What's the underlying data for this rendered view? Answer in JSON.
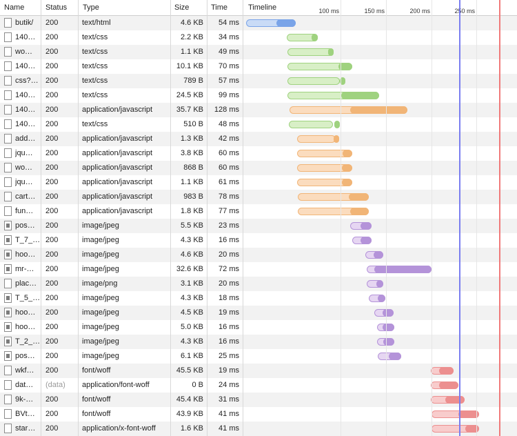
{
  "columns": {
    "name": "Name",
    "status": "Status",
    "type": "Type",
    "size": "Size",
    "time": "Time",
    "timeline": "Timeline"
  },
  "ticks": [
    "100 ms",
    "150 ms",
    "200 ms",
    "250 ms"
  ],
  "colors": {
    "html_light": "#c9dbf6",
    "html_dark": "#7aa4e8",
    "css_light": "#d8efc6",
    "css_dark": "#9fd27f",
    "js_light": "#fbdcbe",
    "js_dark": "#f1b577",
    "img_light": "#e6d6f2",
    "img_dark": "#b493d9",
    "font_light": "#f8cccc",
    "font_dark": "#ec8f8f"
  },
  "rows": [
    {
      "name": "butik/",
      "status": "200",
      "type": "text/html",
      "size": "4.6 KB",
      "time": "54 ms",
      "icon": "file-icon",
      "kind": "html"
    },
    {
      "name": "140…",
      "status": "200",
      "type": "text/css",
      "size": "2.2 KB",
      "time": "34 ms",
      "icon": "file-icon",
      "kind": "css"
    },
    {
      "name": "wo…",
      "status": "200",
      "type": "text/css",
      "size": "1.1 KB",
      "time": "49 ms",
      "icon": "file-icon",
      "kind": "css"
    },
    {
      "name": "140…",
      "status": "200",
      "type": "text/css",
      "size": "10.1 KB",
      "time": "70 ms",
      "icon": "file-icon",
      "kind": "css"
    },
    {
      "name": "css?…",
      "status": "200",
      "type": "text/css",
      "size": "789 B",
      "time": "57 ms",
      "icon": "file-icon",
      "kind": "css"
    },
    {
      "name": "140…",
      "status": "200",
      "type": "text/css",
      "size": "24.5 KB",
      "time": "99 ms",
      "icon": "file-icon",
      "kind": "css"
    },
    {
      "name": "140…",
      "status": "200",
      "type": "application/javascript",
      "size": "35.7 KB",
      "time": "128 ms",
      "icon": "file-icon",
      "kind": "js"
    },
    {
      "name": "140…",
      "status": "200",
      "type": "text/css",
      "size": "510 B",
      "time": "48 ms",
      "icon": "file-icon",
      "kind": "css"
    },
    {
      "name": "add…",
      "status": "200",
      "type": "application/javascript",
      "size": "1.3 KB",
      "time": "42 ms",
      "icon": "file-icon",
      "kind": "js"
    },
    {
      "name": "jqu…",
      "status": "200",
      "type": "application/javascript",
      "size": "3.8 KB",
      "time": "60 ms",
      "icon": "file-icon",
      "kind": "js"
    },
    {
      "name": "wo…",
      "status": "200",
      "type": "application/javascript",
      "size": "868 B",
      "time": "60 ms",
      "icon": "file-icon",
      "kind": "js"
    },
    {
      "name": "jqu…",
      "status": "200",
      "type": "application/javascript",
      "size": "1.1 KB",
      "time": "61 ms",
      "icon": "file-icon",
      "kind": "js"
    },
    {
      "name": "cart…",
      "status": "200",
      "type": "application/javascript",
      "size": "983 B",
      "time": "78 ms",
      "icon": "file-icon",
      "kind": "js"
    },
    {
      "name": "fun…",
      "status": "200",
      "type": "application/javascript",
      "size": "1.8 KB",
      "time": "77 ms",
      "icon": "file-icon",
      "kind": "js"
    },
    {
      "name": "pos…",
      "status": "200",
      "type": "image/jpeg",
      "size": "5.5 KB",
      "time": "23 ms",
      "icon": "image-thumbnail-icon",
      "kind": "img"
    },
    {
      "name": "T_7_…",
      "status": "200",
      "type": "image/jpeg",
      "size": "4.3 KB",
      "time": "16 ms",
      "icon": "image-thumbnail-icon",
      "kind": "img"
    },
    {
      "name": "hoo…",
      "status": "200",
      "type": "image/jpeg",
      "size": "4.6 KB",
      "time": "20 ms",
      "icon": "image-thumbnail-icon",
      "kind": "img"
    },
    {
      "name": "mr-…",
      "status": "200",
      "type": "image/jpeg",
      "size": "32.6 KB",
      "time": "72 ms",
      "icon": "image-thumbnail-icon",
      "kind": "img"
    },
    {
      "name": "plac…",
      "status": "200",
      "type": "image/png",
      "size": "3.1 KB",
      "time": "20 ms",
      "icon": "file-icon",
      "kind": "img"
    },
    {
      "name": "T_5_…",
      "status": "200",
      "type": "image/jpeg",
      "size": "4.3 KB",
      "time": "18 ms",
      "icon": "image-thumbnail-icon",
      "kind": "img"
    },
    {
      "name": "hoo…",
      "status": "200",
      "type": "image/jpeg",
      "size": "4.5 KB",
      "time": "19 ms",
      "icon": "image-thumbnail-icon",
      "kind": "img"
    },
    {
      "name": "hoo…",
      "status": "200",
      "type": "image/jpeg",
      "size": "5.0 KB",
      "time": "16 ms",
      "icon": "image-thumbnail-icon",
      "kind": "img"
    },
    {
      "name": "T_2_…",
      "status": "200",
      "type": "image/jpeg",
      "size": "4.3 KB",
      "time": "16 ms",
      "icon": "image-thumbnail-icon",
      "kind": "img"
    },
    {
      "name": "pos…",
      "status": "200",
      "type": "image/jpeg",
      "size": "6.1 KB",
      "time": "25 ms",
      "icon": "image-thumbnail-icon",
      "kind": "img"
    },
    {
      "name": "wkf…",
      "status": "200",
      "type": "font/woff",
      "size": "45.5 KB",
      "time": "19 ms",
      "icon": "file-icon",
      "kind": "font"
    },
    {
      "name": "dat…",
      "status": "(data)",
      "type": "application/font-woff",
      "size": "0 B",
      "time": "24 ms",
      "icon": "file-icon",
      "kind": "font"
    },
    {
      "name": "9k-…",
      "status": "200",
      "type": "font/woff",
      "size": "45.4 KB",
      "time": "31 ms",
      "icon": "file-icon",
      "kind": "font"
    },
    {
      "name": "BVt…",
      "status": "200",
      "type": "font/woff",
      "size": "43.9 KB",
      "time": "41 ms",
      "icon": "file-icon",
      "kind": "font"
    },
    {
      "name": "star…",
      "status": "200",
      "type": "application/x-font-woff",
      "size": "1.6 KB",
      "time": "41 ms",
      "icon": "file-icon",
      "kind": "font"
    }
  ],
  "timings_ms": [
    [
      0,
      33,
      54
    ],
    [
      44,
      71,
      78
    ],
    [
      45,
      89,
      94
    ],
    [
      45,
      100,
      115
    ],
    [
      45,
      102,
      102
    ],
    [
      45,
      103,
      144
    ],
    [
      47,
      113,
      175
    ],
    [
      46,
      96,
      94
    ],
    [
      55,
      95,
      97
    ],
    [
      55,
      105,
      115
    ],
    [
      55,
      104,
      115
    ],
    [
      55,
      104,
      115
    ],
    [
      56,
      111,
      133
    ],
    [
      56,
      113,
      133
    ],
    [
      113,
      124,
      136
    ],
    [
      115,
      124,
      136
    ],
    [
      129,
      138,
      149
    ],
    [
      131,
      139,
      201
    ],
    [
      131,
      141,
      149
    ],
    [
      133,
      143,
      151
    ],
    [
      139,
      148,
      160
    ],
    [
      142,
      148,
      161
    ],
    [
      142,
      149,
      161
    ],
    [
      143,
      155,
      168
    ],
    [
      200,
      209,
      225
    ],
    [
      200,
      209,
      230
    ],
    [
      200,
      216,
      237
    ],
    [
      201,
      230,
      253
    ],
    [
      201,
      238,
      253
    ]
  ],
  "timeline_scale": {
    "origin_ms": 0,
    "max_ms": 290
  },
  "markers_ms": {
    "dom_content_loaded": 244,
    "load": 289
  }
}
